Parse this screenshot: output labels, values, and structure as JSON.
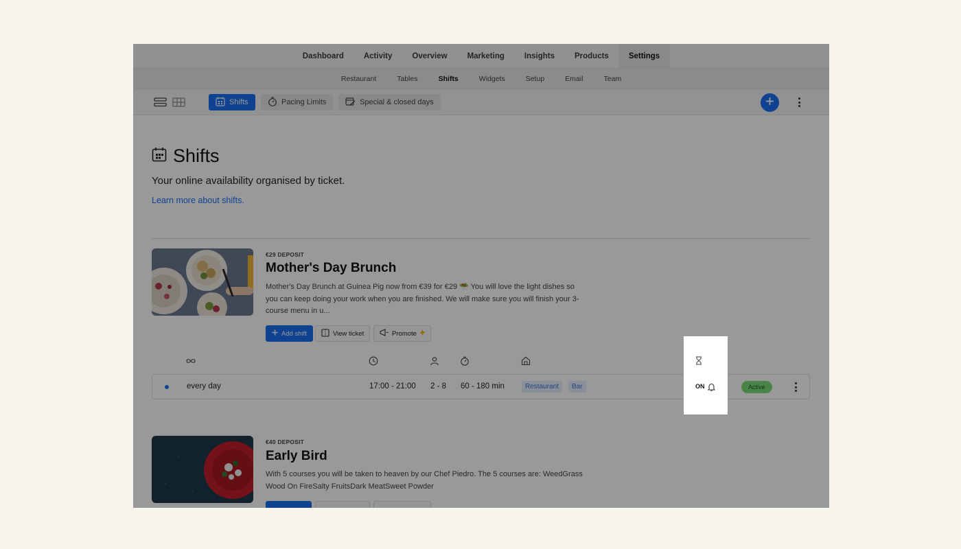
{
  "top_nav": {
    "items": [
      {
        "label": "Dashboard"
      },
      {
        "label": "Activity"
      },
      {
        "label": "Overview"
      },
      {
        "label": "Marketing"
      },
      {
        "label": "Insights"
      },
      {
        "label": "Products"
      },
      {
        "label": "Settings",
        "active": true
      }
    ]
  },
  "sub_nav": {
    "items": [
      {
        "label": "Restaurant"
      },
      {
        "label": "Tables"
      },
      {
        "label": "Shifts",
        "active": true
      },
      {
        "label": "Widgets"
      },
      {
        "label": "Setup"
      },
      {
        "label": "Email"
      },
      {
        "label": "Team"
      }
    ]
  },
  "toolbar": {
    "shifts_label": "Shifts",
    "pacing_label": "Pacing Limits",
    "special_label": "Special & closed days"
  },
  "page": {
    "title": "Shifts",
    "subtitle": "Your online availability organised by ticket.",
    "learn_more": "Learn more about shifts."
  },
  "tickets": [
    {
      "deposit": "€29 DEPOSIT",
      "title": "Mother's Day Brunch",
      "description": "Mother's Day Brunch at Guinea Pig now from €39 for €29 🥗 You will love the light dishes so you can keep doing your work when you are finished. We will make sure you will finish your 3-course menu in u...",
      "add_shift": "Add shift",
      "view_ticket": "View ticket",
      "promote": "Promote",
      "shift": {
        "recurrence": "every day",
        "time": "17:00 - 21:00",
        "guests": "2 - 8",
        "duration": "60 - 180 min",
        "areas": [
          "Restaurant",
          "Bar"
        ],
        "waitlist": "ON",
        "status": "Active"
      }
    },
    {
      "deposit": "€40 DEPOSIT",
      "title": "Early Bird",
      "description": "With 5 courses you will be taken to heaven by our Chef Piedro. The 5 courses are: WeedGrass Wood On FireSalty FruitsDark MeatSweet Powder"
    }
  ],
  "colors": {
    "accent": "#1a6ff2",
    "active_badge": "#7ddc7a",
    "overlay": "rgba(0,0,0,0.4)",
    "background": "#f8f5ef"
  },
  "icons": [
    "list-view-icon",
    "grid-view-icon",
    "calendar-icon",
    "timer-icon",
    "calendar-edit-icon",
    "plus-icon",
    "more-vertical-icon",
    "infinity-icon",
    "clock-icon",
    "guests-icon",
    "stopwatch-icon",
    "area-icon",
    "hourglass-icon",
    "bell-icon",
    "megaphone-icon",
    "lightning-icon",
    "ticket-icon"
  ]
}
